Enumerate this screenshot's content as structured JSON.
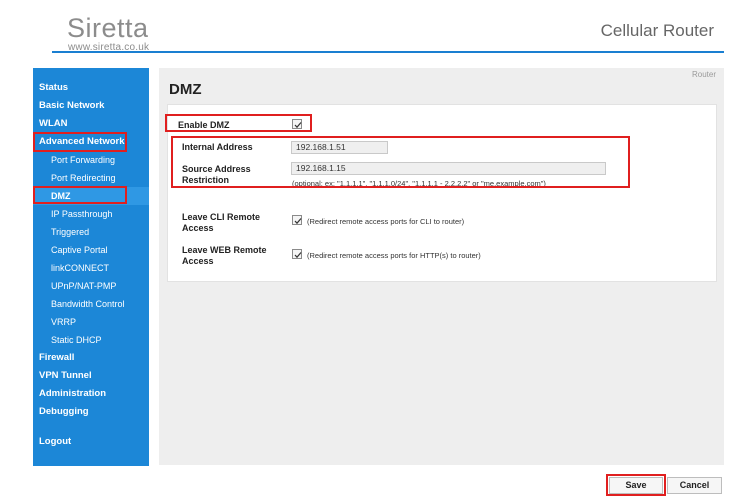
{
  "header": {
    "brand": "Siretta",
    "brand_url": "www.siretta.co.uk",
    "product": "Cellular Router"
  },
  "sidebar": {
    "items": [
      {
        "label": "Status",
        "level": "top"
      },
      {
        "label": "Basic Network",
        "level": "top"
      },
      {
        "label": "WLAN",
        "level": "top"
      },
      {
        "label": "Advanced Network",
        "level": "top"
      },
      {
        "label": "Port Forwarding",
        "level": "sub"
      },
      {
        "label": "Port Redirecting",
        "level": "sub"
      },
      {
        "label": "DMZ",
        "level": "sub",
        "active": true
      },
      {
        "label": "IP Passthrough",
        "level": "sub"
      },
      {
        "label": "Triggered",
        "level": "sub"
      },
      {
        "label": "Captive Portal",
        "level": "sub"
      },
      {
        "label": "linkCONNECT",
        "level": "sub"
      },
      {
        "label": "UPnP/NAT-PMP",
        "level": "sub"
      },
      {
        "label": "Bandwidth Control",
        "level": "sub"
      },
      {
        "label": "VRRP",
        "level": "sub"
      },
      {
        "label": "Static DHCP",
        "level": "sub"
      },
      {
        "label": "Firewall",
        "level": "top"
      },
      {
        "label": "VPN Tunnel",
        "level": "top"
      },
      {
        "label": "Administration",
        "level": "top"
      },
      {
        "label": "Debugging",
        "level": "top"
      },
      {
        "label": "Logout",
        "level": "top"
      }
    ]
  },
  "page": {
    "breadcrumb": "Router",
    "title": "DMZ",
    "enable_dmz": {
      "label": "Enable DMZ",
      "checked": true
    },
    "internal_address": {
      "label": "Internal Address",
      "value": "192.168.1.51"
    },
    "source_restriction": {
      "label_line1": "Source Address",
      "label_line2": "Restriction",
      "value": "192.168.1.15",
      "hint": "(optional; ex: \"1.1.1.1\", \"1.1.1.0/24\", \"1.1.1.1 - 2.2.2.2\" or \"me.example.com\")"
    },
    "leave_cli": {
      "label_line1": "Leave CLI Remote",
      "label_line2": "Access",
      "checked": true,
      "hint": "(Redirect remote access ports for CLI to router)"
    },
    "leave_web": {
      "label_line1": "Leave WEB Remote",
      "label_line2": "Access",
      "checked": true,
      "hint": "(Redirect remote access ports for HTTP(s) to router)"
    }
  },
  "buttons": {
    "save": "Save",
    "cancel": "Cancel"
  },
  "colors": {
    "sidebar_bg": "#1c87d7",
    "header_rule": "#1a7fd1",
    "highlight": "#e01f1f"
  }
}
